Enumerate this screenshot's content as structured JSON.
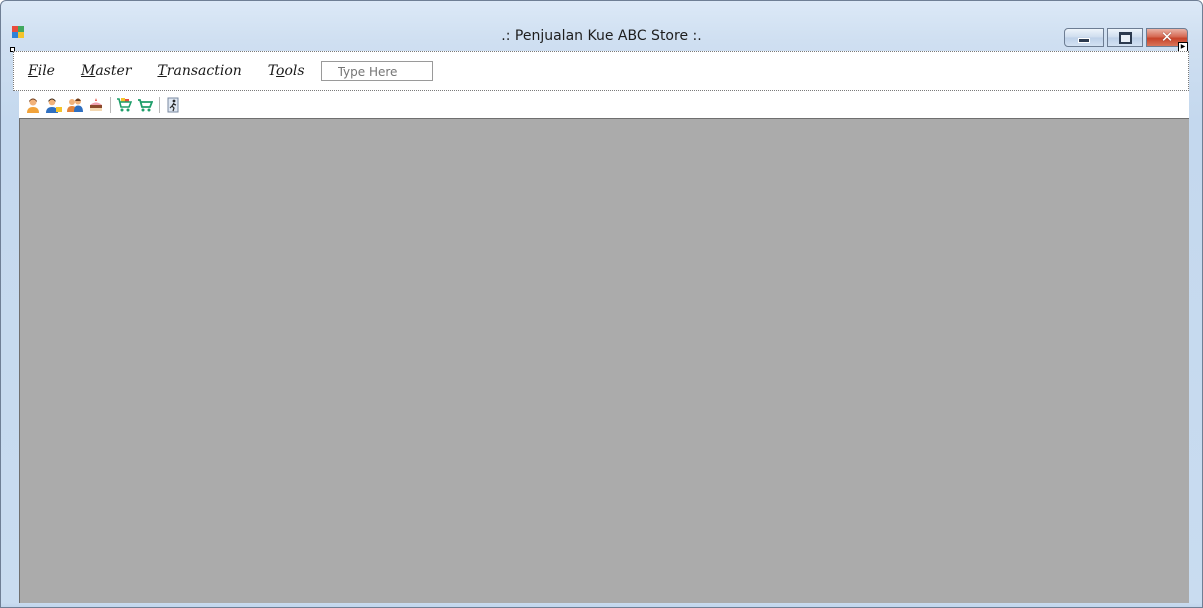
{
  "window": {
    "title": ".: Penjualan Kue ABC Store :.",
    "colors": {
      "mdi_background": "#ababab",
      "title_gradient_top": "#dce9f7",
      "close_button": "#c7432a"
    },
    "caption_buttons": {
      "minimize_icon": "minimize-icon",
      "maximize_icon": "maximize-icon",
      "close_icon": "close-icon",
      "close_glyph": "✕"
    }
  },
  "menubar": {
    "items": [
      {
        "label_pre": "",
        "mnemonic": "F",
        "label_post": "ile"
      },
      {
        "label_pre": "",
        "mnemonic": "M",
        "label_post": "aster"
      },
      {
        "label_pre": "",
        "mnemonic": "T",
        "label_post": "ransaction"
      },
      {
        "label_pre": "T",
        "mnemonic": "o",
        "label_post": "ols"
      }
    ],
    "type_here_placeholder": "Type Here"
  },
  "toolbar": {
    "icons": [
      "user-icon",
      "user-group-icon",
      "users-icon",
      "cake-icon",
      "cart-full-icon",
      "cart-icon",
      "exit-icon"
    ]
  }
}
